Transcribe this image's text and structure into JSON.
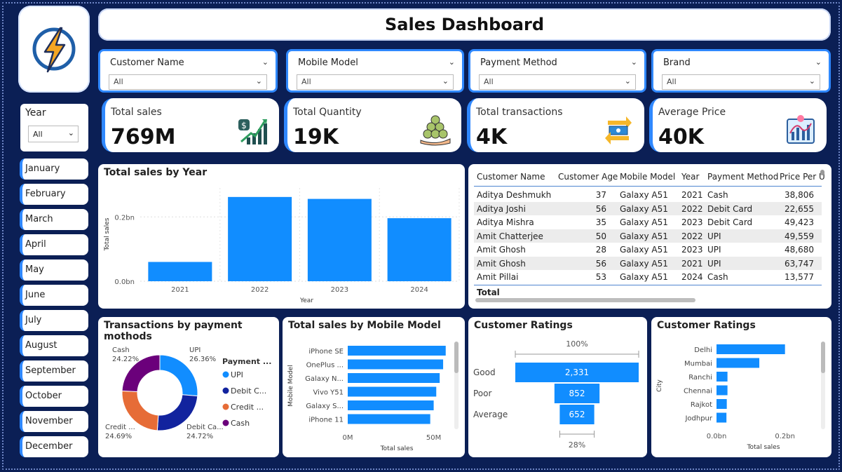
{
  "header": {
    "title": "Sales Dashboard"
  },
  "slicers": [
    {
      "label": "Customer Name",
      "value": "All"
    },
    {
      "label": "Mobile Model",
      "value": "All"
    },
    {
      "label": "Payment Method",
      "value": "All"
    },
    {
      "label": "Brand",
      "value": "All"
    }
  ],
  "kpis": [
    {
      "label": "Total sales",
      "value": "769M",
      "icon": "money-growth-icon"
    },
    {
      "label": "Total Quantity",
      "value": "19K",
      "icon": "coins-hand-icon"
    },
    {
      "label": "Total transactions",
      "value": "4K",
      "icon": "exchange-icon"
    },
    {
      "label": "Average Price",
      "value": "40K",
      "icon": "price-chart-icon"
    }
  ],
  "year_filter": {
    "label": "Year",
    "value": "All"
  },
  "months": [
    "January",
    "February",
    "March",
    "April",
    "May",
    "June",
    "July",
    "August",
    "September",
    "October",
    "November",
    "December"
  ],
  "colors": {
    "accent": "#2f88ff",
    "bar": "#118dff",
    "navy": "#12239e",
    "orange": "#e66c37",
    "purple": "#6b007b",
    "background": "#0b1f55"
  },
  "table": {
    "columns": [
      "Customer Name",
      "Customer Age",
      "Mobile Model",
      "Year",
      "Payment Method",
      "Price Per U"
    ],
    "rows": [
      [
        "Aditya Deshmukh",
        "37",
        "Galaxy A51",
        "2021",
        "Cash",
        "38,806"
      ],
      [
        "Aditya Joshi",
        "56",
        "Galaxy A51",
        "2022",
        "Debit Card",
        "22,655"
      ],
      [
        "Aditya Mishra",
        "35",
        "Galaxy A51",
        "2023",
        "Debit Card",
        "49,423"
      ],
      [
        "Amit Chatterjee",
        "50",
        "Galaxy A51",
        "2022",
        "UPI",
        "49,559"
      ],
      [
        "Amit Ghosh",
        "28",
        "Galaxy A51",
        "2023",
        "UPI",
        "48,680"
      ],
      [
        "Amit Ghosh",
        "56",
        "Galaxy A51",
        "2021",
        "UPI",
        "63,747"
      ],
      [
        "Amit Pillai",
        "53",
        "Galaxy A51",
        "2024",
        "Cash",
        "13,577"
      ]
    ],
    "total_label": "Total"
  },
  "chart_data": [
    {
      "type": "bar",
      "title": "Total sales by Year",
      "xlabel": "Year",
      "ylabel": "Total sales",
      "categories": [
        "2021",
        "2022",
        "2023",
        "2024"
      ],
      "values": [
        0.06,
        0.262,
        0.256,
        0.196
      ],
      "unit": "bn",
      "ylim": [
        0,
        0.29
      ],
      "yticks": [
        {
          "v": 0,
          "label": "0.0bn"
        },
        {
          "v": 0.2,
          "label": "0.2bn"
        }
      ]
    },
    {
      "type": "pie",
      "title": "Transactions by payment mothods",
      "legend_title": "Payment ...",
      "slices": [
        {
          "name": "UPI",
          "legend": "UPI",
          "value": 26.36,
          "label": "UPI",
          "pct": "26.36%",
          "color": "#118dff"
        },
        {
          "name": "Debit Card",
          "legend": "Debit C...",
          "value": 24.72,
          "label": "Debit Ca...",
          "pct": "24.72%",
          "color": "#12239e"
        },
        {
          "name": "Credit Card",
          "legend": "Credit ...",
          "value": 24.69,
          "label": "Credit ...",
          "pct": "24.69%",
          "color": "#e66c37"
        },
        {
          "name": "Cash",
          "legend": "Cash",
          "value": 24.22,
          "label": "Cash",
          "pct": "24.22%",
          "color": "#6b007b"
        }
      ]
    },
    {
      "type": "bar",
      "orientation": "horizontal",
      "title": "Total sales by Mobile Model",
      "xlabel": "Total sales",
      "ylabel": "Mobile Model",
      "categories": [
        "iPhone SE",
        "OnePlus ...",
        "Galaxy N...",
        "Vivo Y51",
        "Galaxy S...",
        "iPhone 11"
      ],
      "values": [
        57,
        55.5,
        53.5,
        51.5,
        50,
        48
      ],
      "unit": "M",
      "xlim": [
        0,
        62
      ],
      "xticks": [
        {
          "v": 0,
          "label": "0M"
        },
        {
          "v": 50,
          "label": "50M"
        }
      ]
    },
    {
      "type": "bar",
      "orientation": "funnel",
      "title": "Customer Ratings",
      "categories": [
        "Good",
        "Poor",
        "Average"
      ],
      "values": [
        2331,
        852,
        652
      ],
      "value_labels": [
        "2,331",
        "852",
        "652"
      ],
      "top_label": "100%",
      "bottom_label": "28%"
    },
    {
      "type": "bar",
      "orientation": "horizontal",
      "title": "Customer Ratings",
      "xlabel": "Total sales",
      "ylabel": "City",
      "categories": [
        "Delhi",
        "Mumbai",
        "Ranchi",
        "Chennai",
        "Rajkot",
        "Jodhpur"
      ],
      "values": [
        0.2,
        0.125,
        0.032,
        0.032,
        0.03,
        0.029
      ],
      "unit": "bn",
      "xlim": [
        0,
        0.26
      ],
      "xticks": [
        {
          "v": 0,
          "label": "0.0bn"
        },
        {
          "v": 0.2,
          "label": "0.2bn"
        }
      ]
    }
  ]
}
